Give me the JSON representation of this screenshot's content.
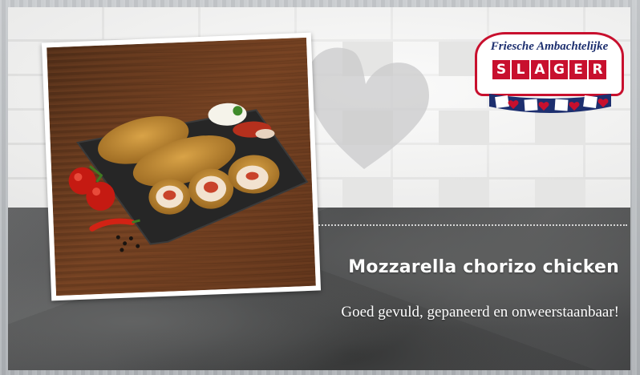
{
  "logo": {
    "name": "Friesche Ambachtelijke",
    "word_letters": [
      "S",
      "L",
      "A",
      "G",
      "E",
      "R"
    ],
    "colors": {
      "red": "#c8102e",
      "blue": "#1d2f6f"
    }
  },
  "product": {
    "title": "Mozzarella chorizo chicken",
    "tagline": "Goed gevuld, gepaneerd en onweerstaanbaar!"
  },
  "icons": {
    "heart": "heart-shadow-icon",
    "photo": "chicken-dish-photo"
  }
}
